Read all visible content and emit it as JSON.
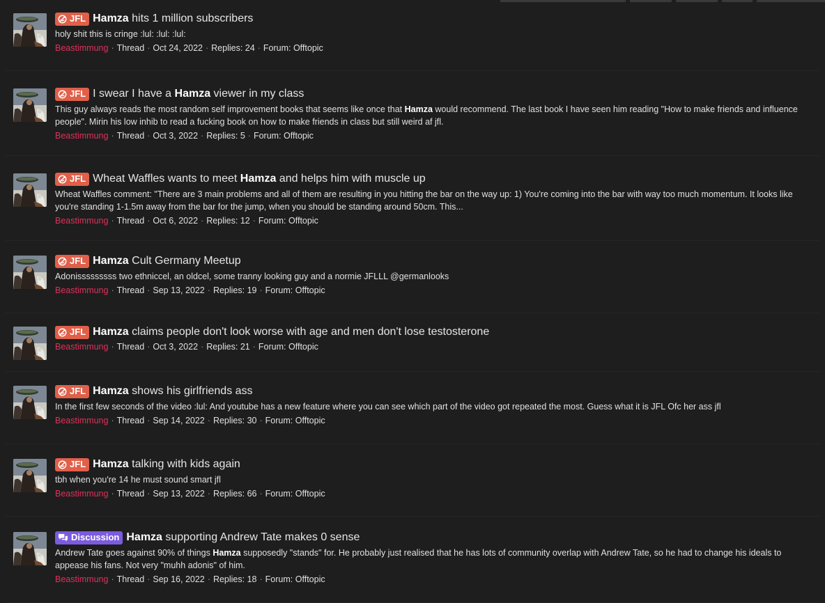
{
  "colors": {
    "background": "#1e1e1e",
    "jfl_prefix": "#e0604a",
    "discussion_prefix": "#7b5bde",
    "username": "#e0305a"
  },
  "meta_labels": {
    "type": "Thread",
    "replies_label": "Replies:",
    "forum_label": "Forum:"
  },
  "results": [
    {
      "prefix": "JFL",
      "prefix_type": "jfl",
      "prefix_icon": "no-laugh-icon",
      "title_pre": "",
      "title_bold": "Hamza",
      "title_post": " hits 1 million subscribers",
      "snippet": [
        [
          "holy shit this is cringe :lul: :lul: :lul:",
          false
        ]
      ],
      "user": "Beastimmung",
      "date": "Oct 24, 2022",
      "replies": "24",
      "forum": "Offtopic"
    },
    {
      "prefix": "JFL",
      "prefix_type": "jfl",
      "prefix_icon": "no-laugh-icon",
      "title_pre": "I swear I have a ",
      "title_bold": "Hamza",
      "title_post": " viewer in my class",
      "snippet": [
        [
          "This guy always reads the most random self improvement books that seems like once that ",
          false
        ],
        [
          "Hamza",
          true
        ],
        [
          " would recommend. The last book I have seen him reading \"How to make friends and influence people\". Mirin his low inhib to read a fucking book on how to make friends in class but still weird af jfl.",
          false
        ]
      ],
      "user": "Beastimmung",
      "date": "Oct 3, 2022",
      "replies": "5",
      "forum": "Offtopic"
    },
    {
      "prefix": "JFL",
      "prefix_type": "jfl",
      "prefix_icon": "no-laugh-icon",
      "title_pre": "Wheat Waffles wants to meet ",
      "title_bold": "Hamza",
      "title_post": " and helps him with muscle up",
      "snippet": [
        [
          "Wheat Waffles comment: \"There are 3 main problems and all of them are resulting in you hitting the bar on the way up: 1) You're coming into the bar with way too much momentum. It looks like you're standing 1-1.5m away from the bar for the jump, when you should be standing around 50cm. This...",
          false
        ]
      ],
      "user": "Beastimmung",
      "date": "Oct 6, 2022",
      "replies": "12",
      "forum": "Offtopic"
    },
    {
      "prefix": "JFL",
      "prefix_type": "jfl",
      "prefix_icon": "no-laugh-icon",
      "title_pre": "",
      "title_bold": "Hamza",
      "title_post": " Cult Germany Meetup",
      "snippet": [
        [
          "Adonisssssssss two ethniccel, an oldcel, some tranny looking guy and a normie JFLLL @germanlooks",
          false
        ]
      ],
      "user": "Beastimmung",
      "date": "Sep 13, 2022",
      "replies": "19",
      "forum": "Offtopic"
    },
    {
      "prefix": "JFL",
      "prefix_type": "jfl",
      "prefix_icon": "no-laugh-icon",
      "title_pre": "",
      "title_bold": "Hamza",
      "title_post": " claims people don't look worse with age and men don't lose testosterone",
      "snippet": [],
      "user": "Beastimmung",
      "date": "Oct 3, 2022",
      "replies": "21",
      "forum": "Offtopic"
    },
    {
      "prefix": "JFL",
      "prefix_type": "jfl",
      "prefix_icon": "no-laugh-icon",
      "title_pre": "",
      "title_bold": "Hamza",
      "title_post": " shows his girlfriends ass",
      "snippet": [
        [
          "In the first few seconds of the video :lul: And youtube has a new feature where you can see which part of the video got repeated the most. Guess what it is JFL Ofc her ass jfl",
          false
        ]
      ],
      "user": "Beastimmung",
      "date": "Sep 14, 2022",
      "replies": "30",
      "forum": "Offtopic"
    },
    {
      "prefix": "JFL",
      "prefix_type": "jfl",
      "prefix_icon": "no-laugh-icon",
      "title_pre": "",
      "title_bold": "Hamza",
      "title_post": " talking with kids again",
      "snippet": [
        [
          "tbh when you're 14 he must sound smart jfl",
          false
        ]
      ],
      "user": "Beastimmung",
      "date": "Sep 13, 2022",
      "replies": "66",
      "forum": "Offtopic"
    },
    {
      "prefix": "Discussion",
      "prefix_type": "disc",
      "prefix_icon": "chat-bubbles-icon",
      "title_pre": "",
      "title_bold": "Hamza",
      "title_post": " supporting Andrew Tate makes 0 sense",
      "snippet": [
        [
          "Andrew Tate goes against 90% of things ",
          false
        ],
        [
          "Hamza",
          true
        ],
        [
          " supposedly \"stands\" for. He probably just realised that he has lots of community overlap with Andrew Tate, so he had to change his ideals to appease his fans. Not very \"muhh adonis\" of him.",
          false
        ]
      ],
      "user": "Beastimmung",
      "date": "Sep 16, 2022",
      "replies": "18",
      "forum": "Offtopic"
    }
  ]
}
